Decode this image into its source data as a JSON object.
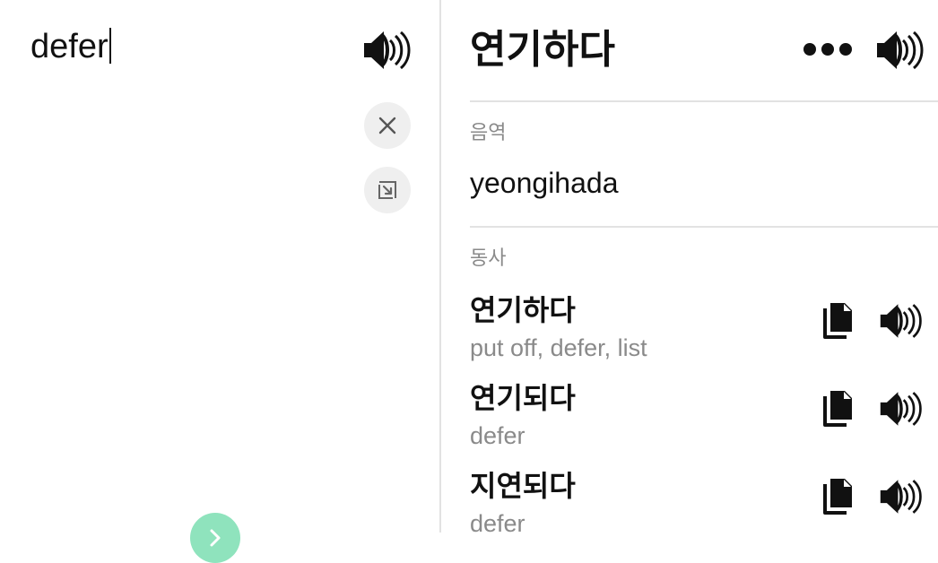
{
  "input": {
    "text": "defer",
    "icons": {
      "speaker": "speaker-icon",
      "clear": "close-icon",
      "collapse": "collapse-arrow-icon",
      "go": "chevron-right-icon"
    }
  },
  "result": {
    "title": "연기하다",
    "transliteration_label": "음역",
    "transliteration": "yeongihada",
    "pos_label": "동사",
    "entries": [
      {
        "word": "연기하다",
        "gloss": "put off, defer, list"
      },
      {
        "word": "연기되다",
        "gloss": "defer"
      },
      {
        "word": "지연되다",
        "gloss": "defer"
      }
    ],
    "icons": {
      "more": "more-dots-icon",
      "copy": "copy-icon",
      "speaker": "speaker-icon"
    }
  },
  "colors": {
    "go_button": "#8fe3bd",
    "divider": "#e2e2e2",
    "muted_text": "#8a8a8a",
    "round_button_bg": "#efefef"
  }
}
